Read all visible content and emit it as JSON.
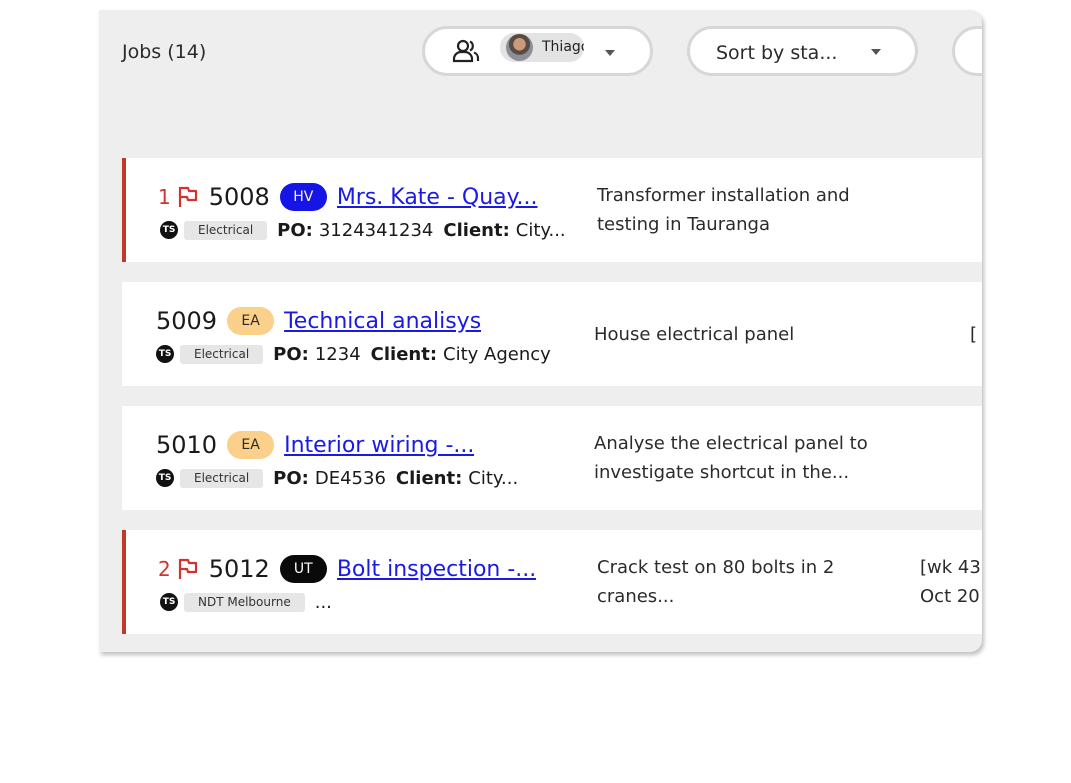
{
  "header": {
    "jobs_title": "Jobs (14)",
    "users_filter": {
      "chip_name": "Thiago"
    },
    "sort": {
      "label": "Sort by sta..."
    }
  },
  "jobs": [
    {
      "priority": "1",
      "number": "5008",
      "badge": "HV",
      "title": "Mrs. Kate - Quay...",
      "assignee_initials": "TS",
      "tag": "Electrical",
      "po_label": "PO:",
      "po": "3124341234",
      "client_label": "Client:",
      "client": "City...",
      "description_line1": "Transformer installation and",
      "description_line2": "testing in Tauranga"
    },
    {
      "number": "5009",
      "badge": "EA",
      "title": "Technical analisys",
      "assignee_initials": "TS",
      "tag": "Electrical",
      "po_label": "PO:",
      "po": "1234",
      "client_label": "Client:",
      "client": "City Agency",
      "description_line1": "House electrical panel",
      "date_fragment": "["
    },
    {
      "number": "5010",
      "badge": "EA",
      "title": "Interior wiring -...",
      "assignee_initials": "TS",
      "tag": "Electrical",
      "po_label": "PO:",
      "po": "DE4536",
      "client_label": "Client:",
      "client": "City...",
      "description_line1": "Analyse the electrical panel to",
      "description_line2": "investigate shortcut in the..."
    },
    {
      "priority": "2",
      "number": "5012",
      "badge": "UT",
      "title": "Bolt inspection -...",
      "assignee_initials": "TS",
      "tag": "NDT Melbourne",
      "extra": "...",
      "description_line1": "Crack test on 80 bolts in 2",
      "description_line2": "cranes...",
      "date_line1": "[wk 43",
      "date_line2": "Oct 20"
    }
  ],
  "colors": {
    "flag": "#d0342c",
    "badge_hv": "#1515e8",
    "badge_ea": "#fbd08a",
    "badge_ut": "#0a0a0a",
    "link": "#1a1ae6"
  }
}
